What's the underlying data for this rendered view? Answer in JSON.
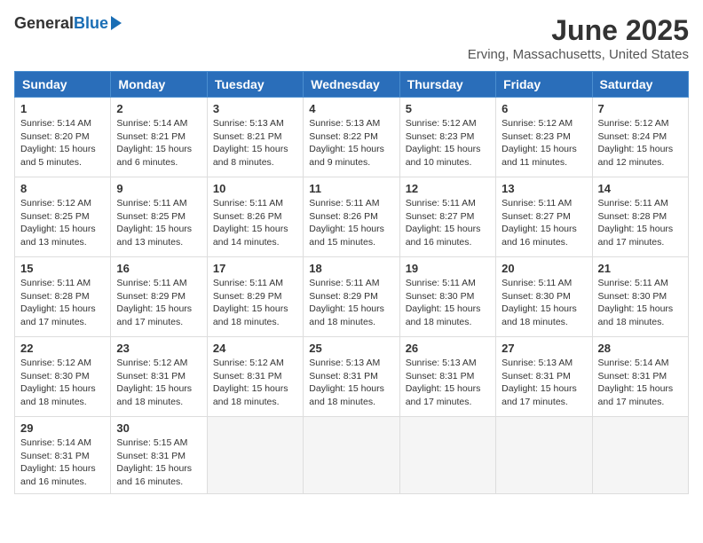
{
  "logo": {
    "general": "General",
    "blue": "Blue"
  },
  "title": "June 2025",
  "location": "Erving, Massachusetts, United States",
  "headers": [
    "Sunday",
    "Monday",
    "Tuesday",
    "Wednesday",
    "Thursday",
    "Friday",
    "Saturday"
  ],
  "weeks": [
    [
      {
        "day": "1",
        "sunrise": "Sunrise: 5:14 AM",
        "sunset": "Sunset: 8:20 PM",
        "daylight": "Daylight: 15 hours and 5 minutes."
      },
      {
        "day": "2",
        "sunrise": "Sunrise: 5:14 AM",
        "sunset": "Sunset: 8:21 PM",
        "daylight": "Daylight: 15 hours and 6 minutes."
      },
      {
        "day": "3",
        "sunrise": "Sunrise: 5:13 AM",
        "sunset": "Sunset: 8:21 PM",
        "daylight": "Daylight: 15 hours and 8 minutes."
      },
      {
        "day": "4",
        "sunrise": "Sunrise: 5:13 AM",
        "sunset": "Sunset: 8:22 PM",
        "daylight": "Daylight: 15 hours and 9 minutes."
      },
      {
        "day": "5",
        "sunrise": "Sunrise: 5:12 AM",
        "sunset": "Sunset: 8:23 PM",
        "daylight": "Daylight: 15 hours and 10 minutes."
      },
      {
        "day": "6",
        "sunrise": "Sunrise: 5:12 AM",
        "sunset": "Sunset: 8:23 PM",
        "daylight": "Daylight: 15 hours and 11 minutes."
      },
      {
        "day": "7",
        "sunrise": "Sunrise: 5:12 AM",
        "sunset": "Sunset: 8:24 PM",
        "daylight": "Daylight: 15 hours and 12 minutes."
      }
    ],
    [
      {
        "day": "8",
        "sunrise": "Sunrise: 5:12 AM",
        "sunset": "Sunset: 8:25 PM",
        "daylight": "Daylight: 15 hours and 13 minutes."
      },
      {
        "day": "9",
        "sunrise": "Sunrise: 5:11 AM",
        "sunset": "Sunset: 8:25 PM",
        "daylight": "Daylight: 15 hours and 13 minutes."
      },
      {
        "day": "10",
        "sunrise": "Sunrise: 5:11 AM",
        "sunset": "Sunset: 8:26 PM",
        "daylight": "Daylight: 15 hours and 14 minutes."
      },
      {
        "day": "11",
        "sunrise": "Sunrise: 5:11 AM",
        "sunset": "Sunset: 8:26 PM",
        "daylight": "Daylight: 15 hours and 15 minutes."
      },
      {
        "day": "12",
        "sunrise": "Sunrise: 5:11 AM",
        "sunset": "Sunset: 8:27 PM",
        "daylight": "Daylight: 15 hours and 16 minutes."
      },
      {
        "day": "13",
        "sunrise": "Sunrise: 5:11 AM",
        "sunset": "Sunset: 8:27 PM",
        "daylight": "Daylight: 15 hours and 16 minutes."
      },
      {
        "day": "14",
        "sunrise": "Sunrise: 5:11 AM",
        "sunset": "Sunset: 8:28 PM",
        "daylight": "Daylight: 15 hours and 17 minutes."
      }
    ],
    [
      {
        "day": "15",
        "sunrise": "Sunrise: 5:11 AM",
        "sunset": "Sunset: 8:28 PM",
        "daylight": "Daylight: 15 hours and 17 minutes."
      },
      {
        "day": "16",
        "sunrise": "Sunrise: 5:11 AM",
        "sunset": "Sunset: 8:29 PM",
        "daylight": "Daylight: 15 hours and 17 minutes."
      },
      {
        "day": "17",
        "sunrise": "Sunrise: 5:11 AM",
        "sunset": "Sunset: 8:29 PM",
        "daylight": "Daylight: 15 hours and 18 minutes."
      },
      {
        "day": "18",
        "sunrise": "Sunrise: 5:11 AM",
        "sunset": "Sunset: 8:29 PM",
        "daylight": "Daylight: 15 hours and 18 minutes."
      },
      {
        "day": "19",
        "sunrise": "Sunrise: 5:11 AM",
        "sunset": "Sunset: 8:30 PM",
        "daylight": "Daylight: 15 hours and 18 minutes."
      },
      {
        "day": "20",
        "sunrise": "Sunrise: 5:11 AM",
        "sunset": "Sunset: 8:30 PM",
        "daylight": "Daylight: 15 hours and 18 minutes."
      },
      {
        "day": "21",
        "sunrise": "Sunrise: 5:11 AM",
        "sunset": "Sunset: 8:30 PM",
        "daylight": "Daylight: 15 hours and 18 minutes."
      }
    ],
    [
      {
        "day": "22",
        "sunrise": "Sunrise: 5:12 AM",
        "sunset": "Sunset: 8:30 PM",
        "daylight": "Daylight: 15 hours and 18 minutes."
      },
      {
        "day": "23",
        "sunrise": "Sunrise: 5:12 AM",
        "sunset": "Sunset: 8:31 PM",
        "daylight": "Daylight: 15 hours and 18 minutes."
      },
      {
        "day": "24",
        "sunrise": "Sunrise: 5:12 AM",
        "sunset": "Sunset: 8:31 PM",
        "daylight": "Daylight: 15 hours and 18 minutes."
      },
      {
        "day": "25",
        "sunrise": "Sunrise: 5:13 AM",
        "sunset": "Sunset: 8:31 PM",
        "daylight": "Daylight: 15 hours and 18 minutes."
      },
      {
        "day": "26",
        "sunrise": "Sunrise: 5:13 AM",
        "sunset": "Sunset: 8:31 PM",
        "daylight": "Daylight: 15 hours and 17 minutes."
      },
      {
        "day": "27",
        "sunrise": "Sunrise: 5:13 AM",
        "sunset": "Sunset: 8:31 PM",
        "daylight": "Daylight: 15 hours and 17 minutes."
      },
      {
        "day": "28",
        "sunrise": "Sunrise: 5:14 AM",
        "sunset": "Sunset: 8:31 PM",
        "daylight": "Daylight: 15 hours and 17 minutes."
      }
    ],
    [
      {
        "day": "29",
        "sunrise": "Sunrise: 5:14 AM",
        "sunset": "Sunset: 8:31 PM",
        "daylight": "Daylight: 15 hours and 16 minutes."
      },
      {
        "day": "30",
        "sunrise": "Sunrise: 5:15 AM",
        "sunset": "Sunset: 8:31 PM",
        "daylight": "Daylight: 15 hours and 16 minutes."
      },
      null,
      null,
      null,
      null,
      null
    ]
  ]
}
